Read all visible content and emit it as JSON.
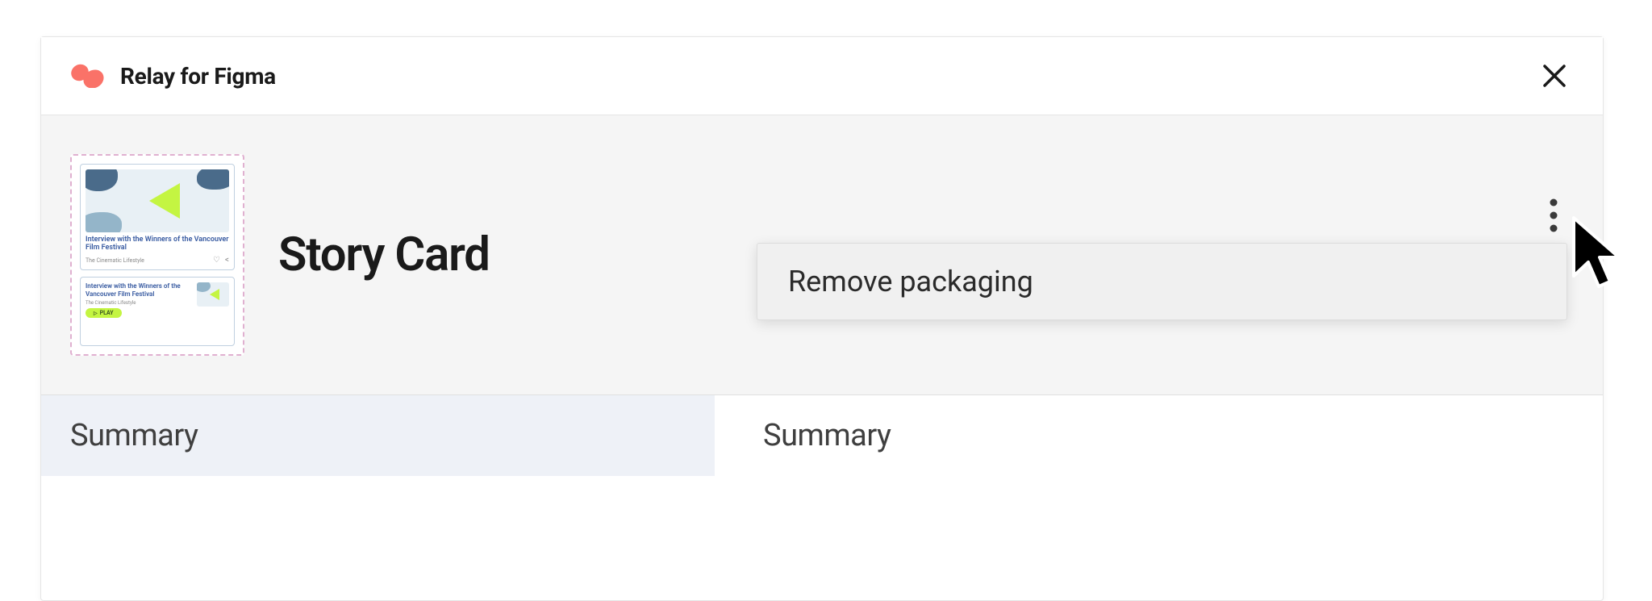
{
  "header": {
    "title": "Relay for Figma"
  },
  "component": {
    "title": "Story Card",
    "thumbnail": {
      "card_big": {
        "headline": "Interview with the Winners of the Vancouver Film Festival",
        "subline": "The Cinematic Lifestyle"
      },
      "card_small": {
        "headline": "Interview with the Winners of the Vancouver Film Festival",
        "subline": "The Cinematic Lifestyle",
        "play_label": "PLAY"
      }
    }
  },
  "menu": {
    "items": [
      {
        "label": "Remove packaging"
      }
    ]
  },
  "tabs": {
    "left": "Summary",
    "right": "Summary"
  }
}
